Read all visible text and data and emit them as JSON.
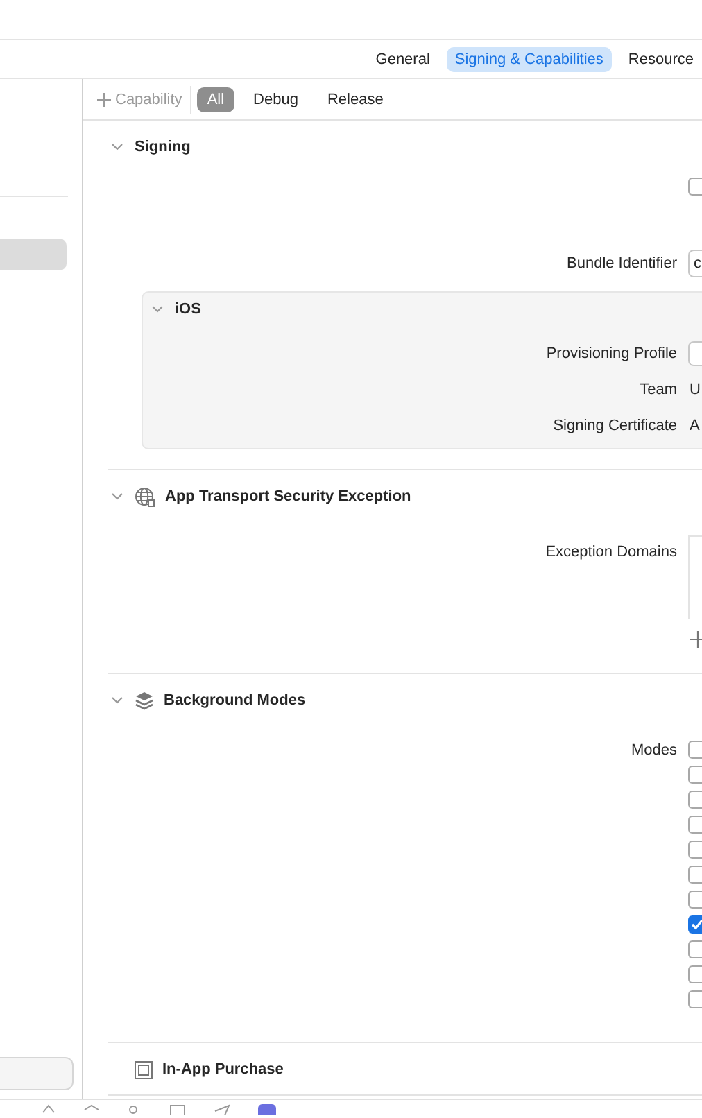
{
  "tabs": [
    {
      "label": "General",
      "selected": false
    },
    {
      "label": "Signing & Capabilities",
      "selected": true
    },
    {
      "label": "Resource",
      "selected": false
    }
  ],
  "capability_bar": {
    "add_button": "Capability",
    "filters": [
      {
        "label": "All",
        "selected": true
      },
      {
        "label": "Debug",
        "selected": false
      },
      {
        "label": "Release",
        "selected": false
      }
    ]
  },
  "sections": [
    {
      "title": "Signing",
      "kind": "signing",
      "expanded": true,
      "rows": [
        {
          "kind": "checkbox",
          "checked": false
        },
        {
          "kind": "field",
          "label": "Bundle Identifier",
          "value": "c"
        }
      ],
      "group": {
        "title": "iOS",
        "expanded": true,
        "rows": [
          {
            "kind": "popup",
            "label": "Provisioning Profile"
          },
          {
            "kind": "text",
            "label": "Team",
            "value": "U"
          },
          {
            "kind": "text",
            "label": "Signing Certificate",
            "value": "A"
          }
        ]
      }
    },
    {
      "title": "App Transport Security Exception",
      "kind": "transport",
      "expanded": true,
      "rows": [
        {
          "kind": "table",
          "label": "Exception Domains"
        }
      ]
    },
    {
      "title": "Background Modes",
      "kind": "background",
      "expanded": true,
      "rows": [
        {
          "kind": "checklist",
          "label": "Modes",
          "items": [
            {
              "checked": false
            },
            {
              "checked": false
            },
            {
              "checked": false
            },
            {
              "checked": false
            },
            {
              "checked": false
            },
            {
              "checked": false
            },
            {
              "checked": false
            },
            {
              "checked": true
            },
            {
              "checked": false
            },
            {
              "checked": false
            },
            {
              "checked": false
            }
          ]
        }
      ]
    },
    {
      "title": "In-App Purchase",
      "kind": "purchase"
    }
  ]
}
